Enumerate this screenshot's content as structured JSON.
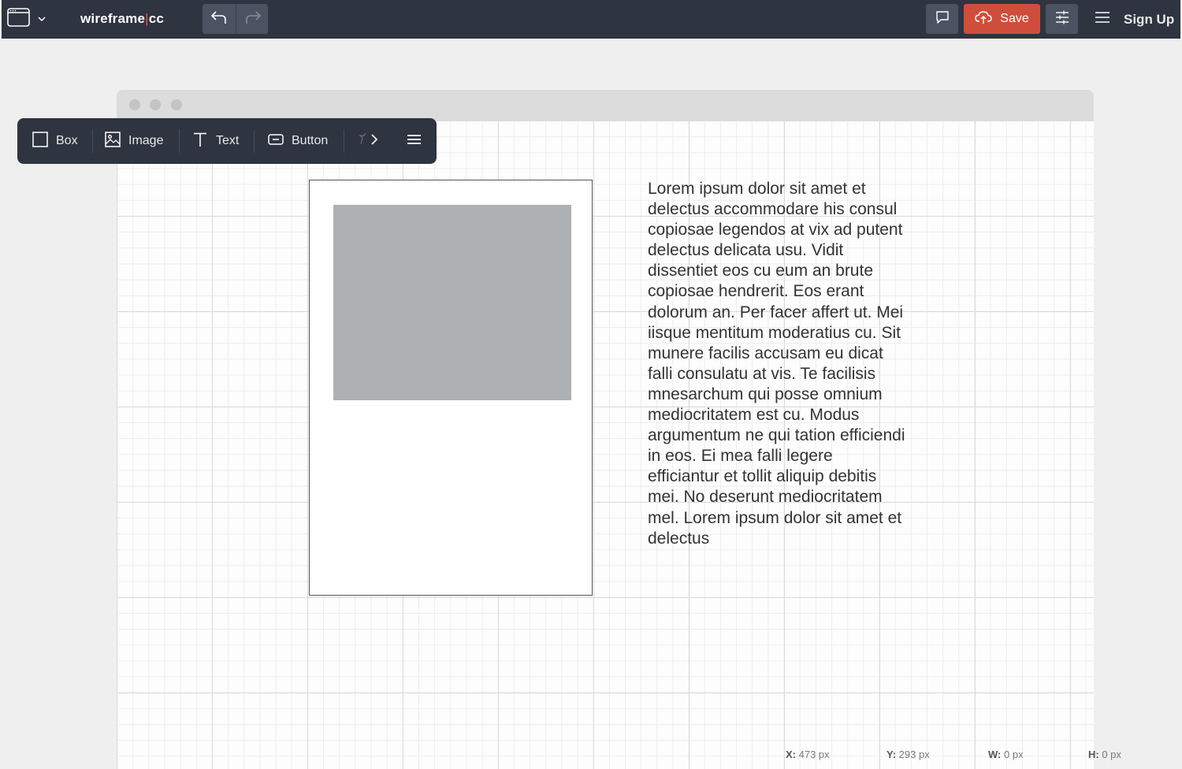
{
  "topbar": {
    "app_menu_icon": "browser-window-icon",
    "app_menu_chevron": "chevron-down-icon",
    "logo_left": "wireframe",
    "logo_separator": "|",
    "logo_right": "cc",
    "undo_icon": "undo-arrow-icon",
    "redo_icon": "redo-arrow-icon",
    "comment_icon": "comment-icon",
    "save_label": "Save",
    "save_icon": "cloud-upload-icon",
    "settings_icon": "sliders-icon",
    "menu_icon": "hamburger-menu-icon",
    "signup_label": "Sign Up",
    "colors": {
      "bar_bg": "#2e3440",
      "save_bg": "#cf4e3b",
      "button_bg": "#4b5262"
    }
  },
  "toolbar": {
    "items": [
      {
        "label": "Box",
        "icon": "box-icon"
      },
      {
        "label": "Image",
        "icon": "image-icon"
      },
      {
        "label": "Text",
        "icon": "text-icon"
      },
      {
        "label": "Button",
        "icon": "button-icon"
      }
    ],
    "more_icon": "chevron-right-icon",
    "menu_icon": "hamburger-menu-icon"
  },
  "canvas": {
    "text_block": "Lorem ipsum dolor sit amet et delectus accommodare his consul copiosae legendos at vix ad putent delectus delicata usu. Vidit dissentiet eos cu eum an brute copiosae hendrerit. Eos erant dolorum an. Per facer affert ut. Mei iisque mentitum moderatius cu. Sit munere facilis accusam eu dicat falli consulatu at vis. Te facilisis mnesarchum qui posse omnium mediocritatem est cu. Modus argumentum ne qui tation efficiendi in eos. Ei mea falli legere efficiantur et tollit aliquip debitis mei. No deserunt mediocritatem mel. Lorem ipsum dolor sit amet et delectus"
  },
  "status": {
    "x_label": "X:",
    "x_value": "473 px",
    "y_label": "Y:",
    "y_value": "293 px",
    "w_label": "W:",
    "w_value": "0 px",
    "h_label": "H:",
    "h_value": "0 px"
  }
}
